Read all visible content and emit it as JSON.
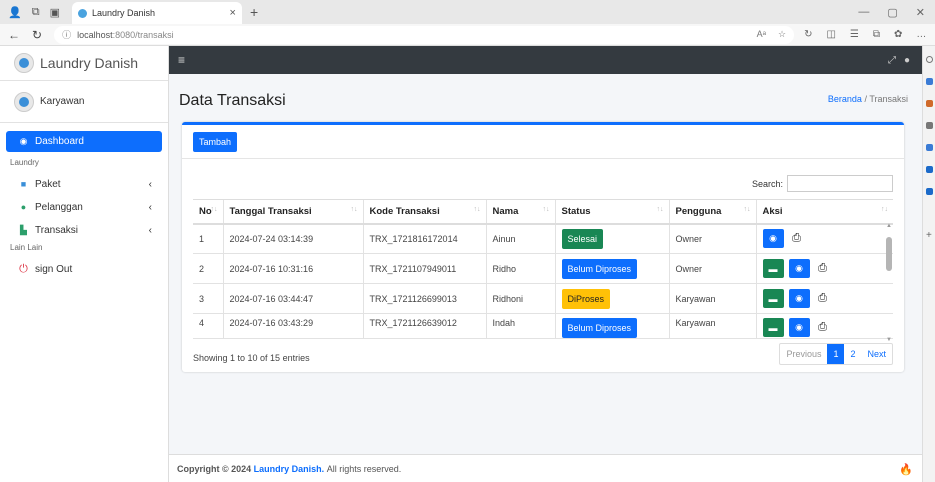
{
  "browser": {
    "tab_title": "Laundry Danish",
    "url_host": "localhost",
    "url_path": ":8080/transaksi"
  },
  "sidebar": {
    "brand": "Laundry Danish",
    "user": "Karyawan",
    "items": [
      {
        "label": "Dashboard",
        "icon": "dashboard-icon"
      },
      {
        "header": "Laundry"
      },
      {
        "label": "Paket",
        "icon": "package-icon"
      },
      {
        "label": "Pelanggan",
        "icon": "users-icon"
      },
      {
        "label": "Transaksi",
        "icon": "cart-icon"
      },
      {
        "header": "Lain Lain"
      },
      {
        "label": "sign Out",
        "icon": "power-icon"
      }
    ]
  },
  "page": {
    "title": "Data Transaksi",
    "breadcrumb_home": "Beranda",
    "breadcrumb_sep": "/",
    "breadcrumb_current": "Transaksi"
  },
  "card": {
    "add_button": "Tambah",
    "search_label": "Search:",
    "search_value": "",
    "columns": [
      "No",
      "Tanggal Transaksi",
      "Kode Transaksi",
      "Nama",
      "Status",
      "Pengguna",
      "Aksi"
    ],
    "rows": [
      {
        "no": "1",
        "date": "2024-07-24 03:14:39",
        "code": "TRX_1721816172014",
        "name": "Ainun",
        "status": "Selesai",
        "status_color": "#198754",
        "user": "Owner",
        "actions": [
          "view",
          "print"
        ]
      },
      {
        "no": "2",
        "date": "2024-07-16 10:31:16",
        "code": "TRX_1721107949011",
        "name": "Ridho",
        "status": "Belum Diproses",
        "status_color": "#0d6efd",
        "user": "Owner",
        "actions": [
          "process",
          "view",
          "print"
        ]
      },
      {
        "no": "3",
        "date": "2024-07-16 03:44:47",
        "code": "TRX_1721126699013",
        "name": "Ridhoni",
        "status": "DiProses",
        "status_color": "#ffc107",
        "user": "Karyawan",
        "actions": [
          "process",
          "view",
          "print"
        ]
      },
      {
        "no": "4",
        "date": "2024-07-16 03:43:29",
        "code": "TRX_1721126639012",
        "name": "Indah",
        "status": "Belum Diproses",
        "status_color": "#0d6efd",
        "user": "Karyawan",
        "actions": [
          "process",
          "view",
          "print"
        ]
      }
    ],
    "info": "Showing 1 to 10 of 15 entries",
    "pagination": {
      "previous": "Previous",
      "pages": [
        "1",
        "2"
      ],
      "active": "1",
      "next": "Next"
    }
  },
  "footer": {
    "prefix": "Copyright © 2024",
    "brand": "Laundry Danish.",
    "suffix": "All rights reserved."
  },
  "colors": {
    "primary": "#0d6efd",
    "success": "#198754",
    "warning": "#ffc107",
    "topbar": "#343a40"
  }
}
